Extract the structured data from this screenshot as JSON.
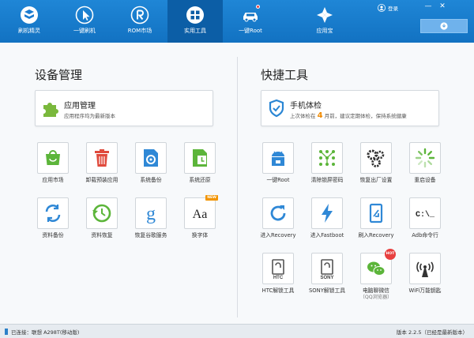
{
  "nav": [
    {
      "label": "刷机精灵",
      "icon": "shield-logo-icon"
    },
    {
      "label": "一键刷机",
      "icon": "cursor-icon"
    },
    {
      "label": "ROM市场",
      "icon": "rom-r-icon"
    },
    {
      "label": "实用工具",
      "icon": "toolbox-grid-icon",
      "active": true
    },
    {
      "label": "一键Root",
      "icon": "root-car-icon",
      "dot": true
    },
    {
      "label": "应用宝",
      "icon": "yingyongbao-icon"
    }
  ],
  "header": {
    "login": "登录",
    "minimize": "—",
    "close": "✕"
  },
  "device": {
    "title": "设备管理",
    "app_manage": {
      "title": "应用管理",
      "subtitle": "应用程序均为最新版本"
    },
    "tools": [
      {
        "label": "应用市场",
        "icon": "market-icon"
      },
      {
        "label": "卸载预装应用",
        "icon": "trash-icon"
      },
      {
        "label": "系统备份",
        "icon": "system-backup-icon"
      },
      {
        "label": "系统还原",
        "icon": "system-restore-icon"
      },
      {
        "label": "资料备份",
        "icon": "data-backup-icon"
      },
      {
        "label": "资料恢复",
        "icon": "data-restore-icon"
      },
      {
        "label": "恢复谷歌服务",
        "icon": "google-icon"
      },
      {
        "label": "换字体",
        "icon": "font-icon",
        "glyph": "Aa",
        "badge": "NEW"
      }
    ]
  },
  "quick": {
    "title": "快捷工具",
    "checkup": {
      "title": "手机体检",
      "subtitle_pre": "上次体检在",
      "days": "4",
      "subtitle_post": "月前，建议定期体检，保持系统健康"
    },
    "tools": [
      {
        "label": "一键Root",
        "icon": "android-root-icon"
      },
      {
        "label": "清除锁屏密码",
        "icon": "pattern-lock-icon"
      },
      {
        "label": "恢复出厂设置",
        "icon": "gears-icon"
      },
      {
        "label": "重启设备",
        "icon": "reboot-spinner-icon"
      },
      {
        "label": "进入Recovery",
        "icon": "refresh-arrow-icon"
      },
      {
        "label": "进入Fastboot",
        "icon": "lightning-icon"
      },
      {
        "label": "刷入Recovery",
        "icon": "phone-flash-icon"
      },
      {
        "label": "Adb命令行",
        "icon": "terminal-icon",
        "glyph": "C:\\_"
      },
      {
        "label": "HTC解锁工具",
        "icon": "htc-icon",
        "glyph": "HTC"
      },
      {
        "label": "SONY解锁工具",
        "icon": "sony-icon",
        "glyph": "SONY"
      },
      {
        "label": "电脑聊微信",
        "sublabel": "（QQ浏览器）",
        "icon": "wechat-icon",
        "badge": "HOT"
      },
      {
        "label": "WiFi万能钥匙",
        "icon": "wifi-key-icon"
      }
    ]
  },
  "status": {
    "connected": "已连接：联想 A298T(移动版)",
    "version": "版本 2.2.5（已经是最新版本）"
  },
  "colors": {
    "accent": "#1a7ccc",
    "nav_active": "#0c5ea6",
    "highlight": "#f08a00",
    "hot": "#e84040",
    "new_badge": "#f29400"
  }
}
